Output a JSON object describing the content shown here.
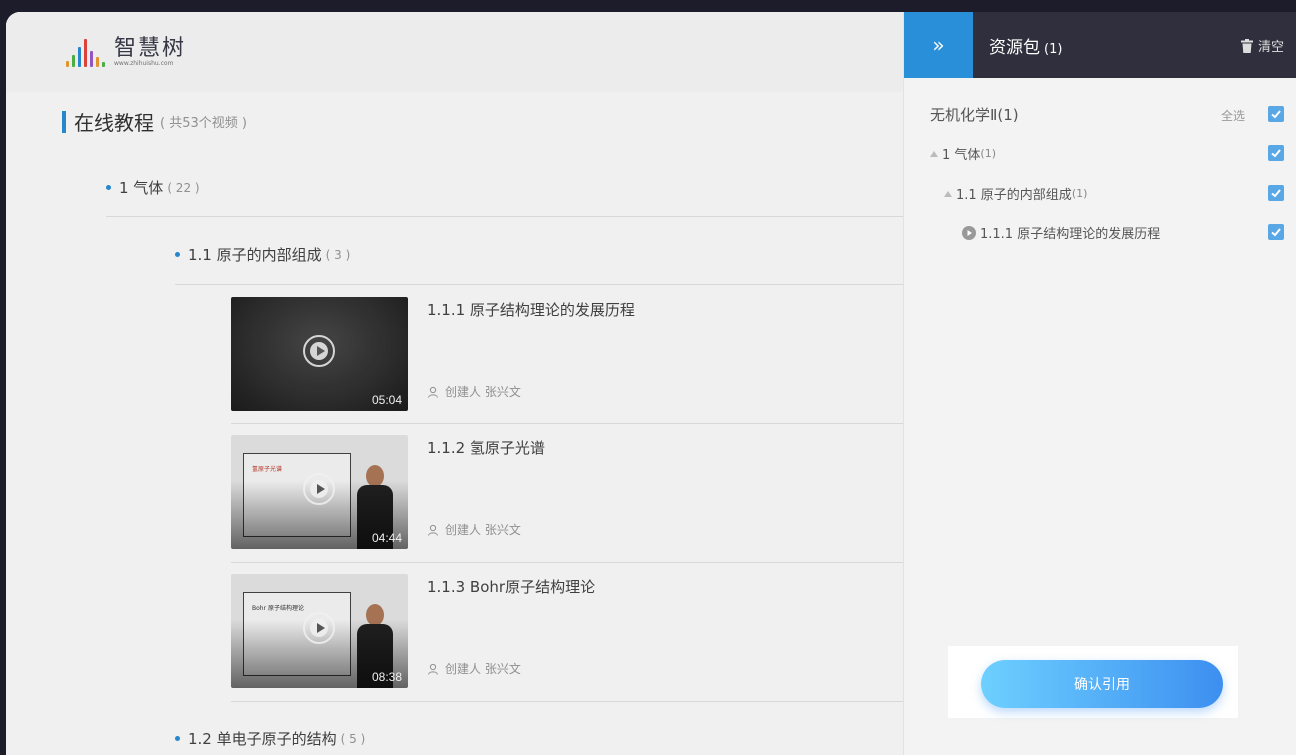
{
  "header": {
    "logo_text": "智慧树",
    "logo_url": "www.zhihuishu.com"
  },
  "section": {
    "title": "在线教程",
    "count": "( 共53个视频 )"
  },
  "tree": {
    "chapter1": {
      "label": "1 气体",
      "count": "( 22 )"
    },
    "section11": {
      "label": "1.1 原子的内部组成",
      "count": "( 3 )"
    },
    "section12": {
      "label": "1.2 单电子原子的结构",
      "count": "( 5 )"
    }
  },
  "videos": [
    {
      "title": "1.1.1 原子结构理论的发展历程",
      "creator": "创建人 张兴文",
      "duration": "05:04"
    },
    {
      "title": "1.1.2 氢原子光谱",
      "creator": "创建人 张兴文",
      "duration": "04:44",
      "slide_text": "氢原子光谱"
    },
    {
      "title": "1.1.3 Bohr原子结构理论",
      "creator": "创建人 张兴文",
      "duration": "08:38",
      "slide_text": "Bohr 原子结构理论"
    }
  ],
  "panel": {
    "collapse_icon": "»",
    "title": "资源包",
    "title_count": "(1)",
    "clear_label": "清空",
    "course": "无机化学Ⅱ(1)",
    "select_all": "全选",
    "items": [
      {
        "label": "1 气体",
        "count": "(1)"
      },
      {
        "label": "1.1 原子的内部组成",
        "count": "(1)"
      },
      {
        "label": "1.1.1 原子结构理论的发展历程"
      }
    ],
    "confirm_label": "确认引用"
  },
  "colors": {
    "accent": "#2a8fd9",
    "panel_header": "#2f2f3d",
    "checkbox": "#5aa7e6"
  }
}
